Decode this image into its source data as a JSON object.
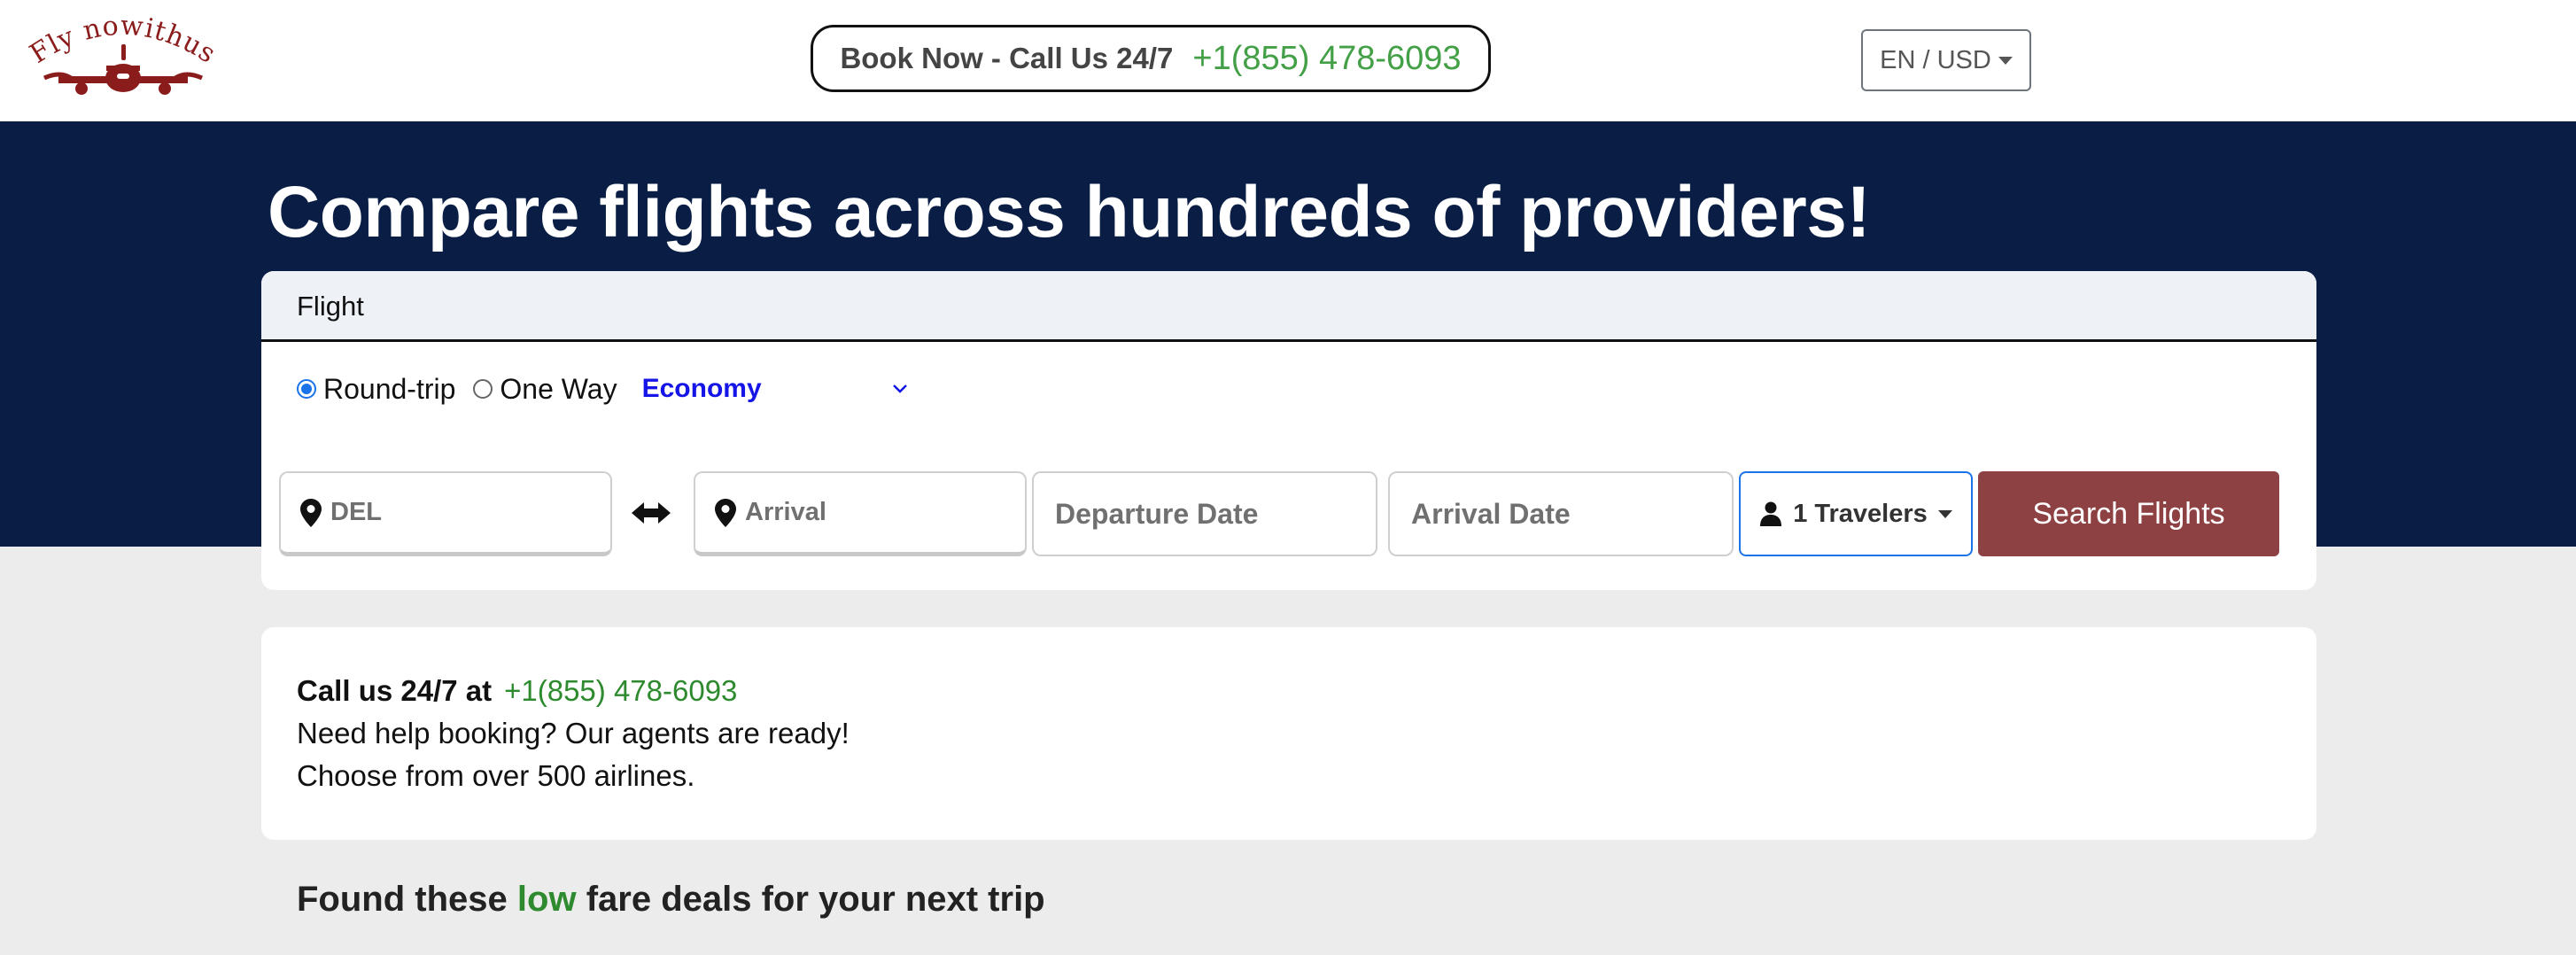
{
  "brand": {
    "logo_text": "Fly nowithus",
    "logo_color": "#8b1c1c"
  },
  "header": {
    "book_label": "Book Now - Call Us 24/7",
    "phone": "+1(855) 478-6093",
    "locale_label": "EN / USD"
  },
  "hero": {
    "title": "Compare flights across hundreds of providers!",
    "background_color": "#0a1e45"
  },
  "search": {
    "tab_label": "Flight",
    "trip_types": [
      {
        "label": "Round-trip",
        "selected": true
      },
      {
        "label": "One Way",
        "selected": false
      }
    ],
    "cabin_class": "Economy",
    "origin_value": "DEL",
    "destination_placeholder": "Arrival",
    "departure_placeholder": "Departure Date",
    "return_placeholder": "Arrival Date",
    "travelers_label": "1 Travelers",
    "search_button": "Search Flights",
    "search_button_color": "#8e4143",
    "icons": [
      "location-pin-icon",
      "swap-arrows-icon",
      "person-icon",
      "chevron-down-icon"
    ]
  },
  "info": {
    "call_label": "Call us 24/7 at",
    "phone": "+1(855) 478-6093",
    "line2": "Need help booking? Our agents are ready!",
    "line3": "Choose from over 500 airlines."
  },
  "deals": {
    "prefix": "Found these",
    "highlight": "low",
    "suffix": "fare deals for your next trip",
    "highlight_color": "#2e8a2e"
  }
}
